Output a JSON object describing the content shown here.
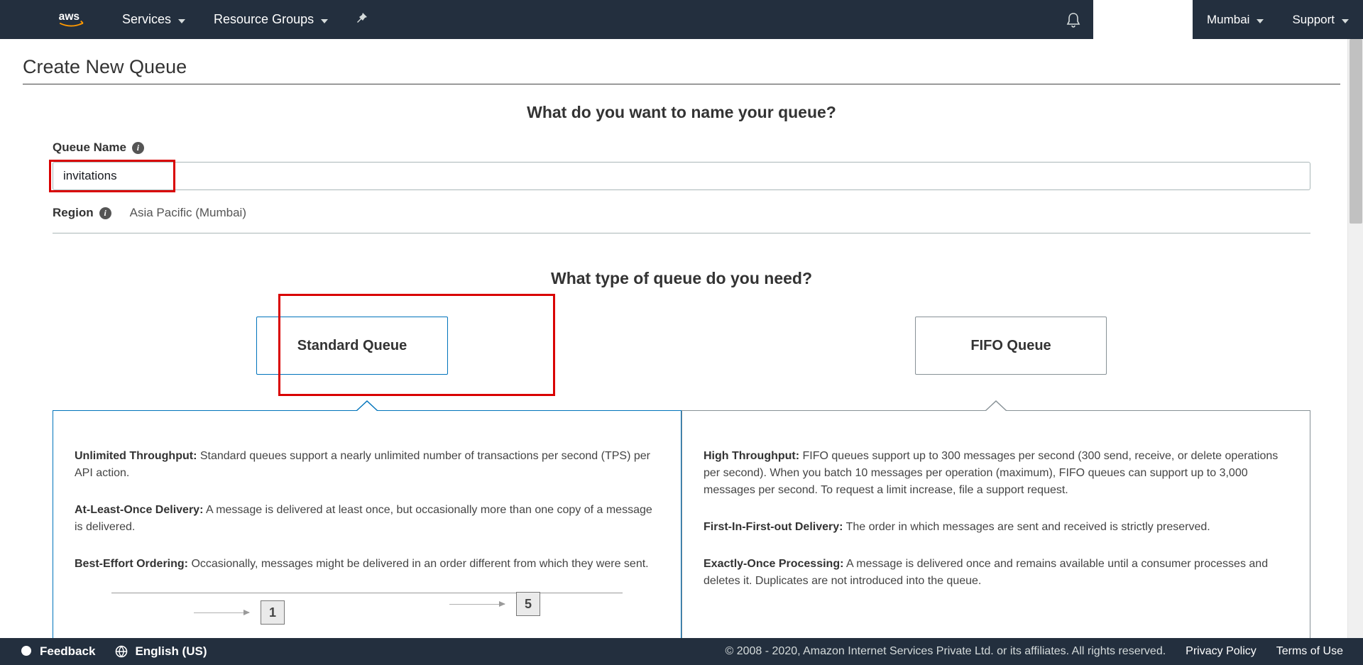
{
  "nav": {
    "services": "Services",
    "resource_groups": "Resource Groups",
    "region": "Mumbai",
    "support": "Support"
  },
  "page": {
    "title": "Create New Queue",
    "name_heading": "What do you want to name your queue?",
    "queue_name_label": "Queue Name",
    "queue_name_value": "invitations",
    "region_label": "Region",
    "region_value": "Asia Pacific (Mumbai)",
    "type_heading": "What type of queue do you need?",
    "standard_label": "Standard Queue",
    "fifo_label": "FIFO Queue"
  },
  "standard": {
    "p1_b": "Unlimited Throughput:",
    "p1": " Standard queues support a nearly unlimited number of transactions per second (TPS) per API action.",
    "p2_b": "At-Least-Once Delivery:",
    "p2": " A message is delivered at least once, but occasionally more than one copy of a message is delivered.",
    "p3_b": "Best-Effort Ordering:",
    "p3": " Occasionally, messages might be delivered in an order different from which they were sent.",
    "d1": "1",
    "d5": "5"
  },
  "fifo": {
    "p1_b": "High Throughput:",
    "p1": " FIFO queues support up to 300 messages per second (300 send, receive, or delete operations per second). When you batch 10 messages per operation (maximum), FIFO queues can support up to 3,000 messages per second. To request a limit increase, file a support request.",
    "p2_b": "First-In-First-out Delivery:",
    "p2": " The order in which messages are sent and received is strictly preserved.",
    "p3_b": "Exactly-Once Processing:",
    "p3": " A message is delivered once and remains available until a consumer processes and deletes it. Duplicates are not introduced into the queue."
  },
  "footer": {
    "feedback": "Feedback",
    "language": "English (US)",
    "copyright": "© 2008 - 2020, Amazon Internet Services Private Ltd. or its affiliates. All rights reserved.",
    "privacy": "Privacy Policy",
    "terms": "Terms of Use"
  }
}
